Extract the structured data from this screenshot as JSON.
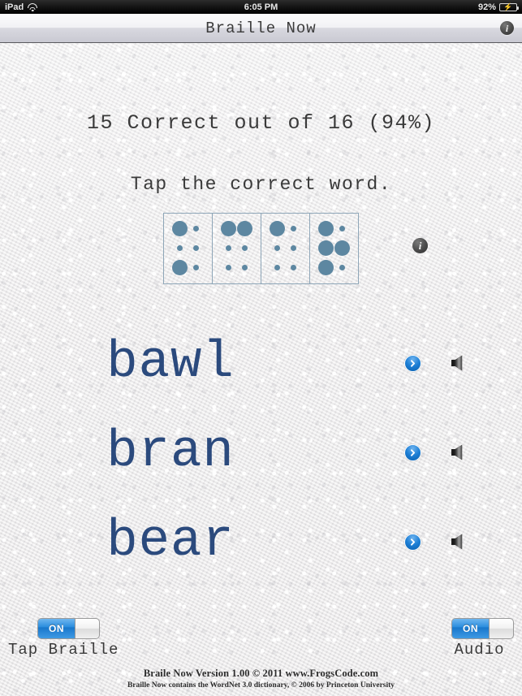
{
  "status_bar": {
    "device": "iPad",
    "wifi_icon": "wifi-icon",
    "time": "6:05 PM",
    "battery_percent": "92%",
    "battery_icon": "battery-charging-icon"
  },
  "navbar": {
    "title": "Braille Now",
    "info_icon": "info-icon"
  },
  "main": {
    "score_text": "15 Correct out of 16 (94%)",
    "prompt_text": "Tap the correct word.",
    "braille": {
      "word": "bear",
      "info_icon": "info-icon",
      "cells": [
        {
          "letter": "b",
          "dots": [
            true,
            false,
            true,
            false,
            false,
            false
          ]
        },
        {
          "letter": "e",
          "dots": [
            true,
            false,
            false,
            true,
            false,
            false
          ]
        },
        {
          "letter": "a",
          "dots": [
            true,
            false,
            false,
            false,
            false,
            false
          ]
        },
        {
          "letter": "r",
          "dots": [
            true,
            true,
            true,
            false,
            true,
            false
          ]
        }
      ]
    },
    "choices": [
      {
        "word": "bawl",
        "chevron_icon": "chevron-right-icon",
        "speaker_icon": "speaker-icon"
      },
      {
        "word": "bran",
        "chevron_icon": "chevron-right-icon",
        "speaker_icon": "speaker-icon"
      },
      {
        "word": "bear",
        "chevron_icon": "chevron-right-icon",
        "speaker_icon": "speaker-icon"
      }
    ]
  },
  "controls": {
    "tap_braille": {
      "state": "ON",
      "label": "Tap Braille"
    },
    "audio": {
      "state": "ON",
      "label": "Audio"
    }
  },
  "footer": {
    "line1": "Braile Now Version 1.00 © 2011 www.FrogsCode.com",
    "line2": "Braille Now contains the WordNet 3.0 dictionary, © 2006 by Princeton University"
  },
  "colors": {
    "word_blue": "#2b4a7d",
    "braille_dot": "#5d87a1",
    "braille_border": "#8ea6b8",
    "switch_blue": "#2b8ede",
    "chevron_blue": "#1d7fd6"
  }
}
